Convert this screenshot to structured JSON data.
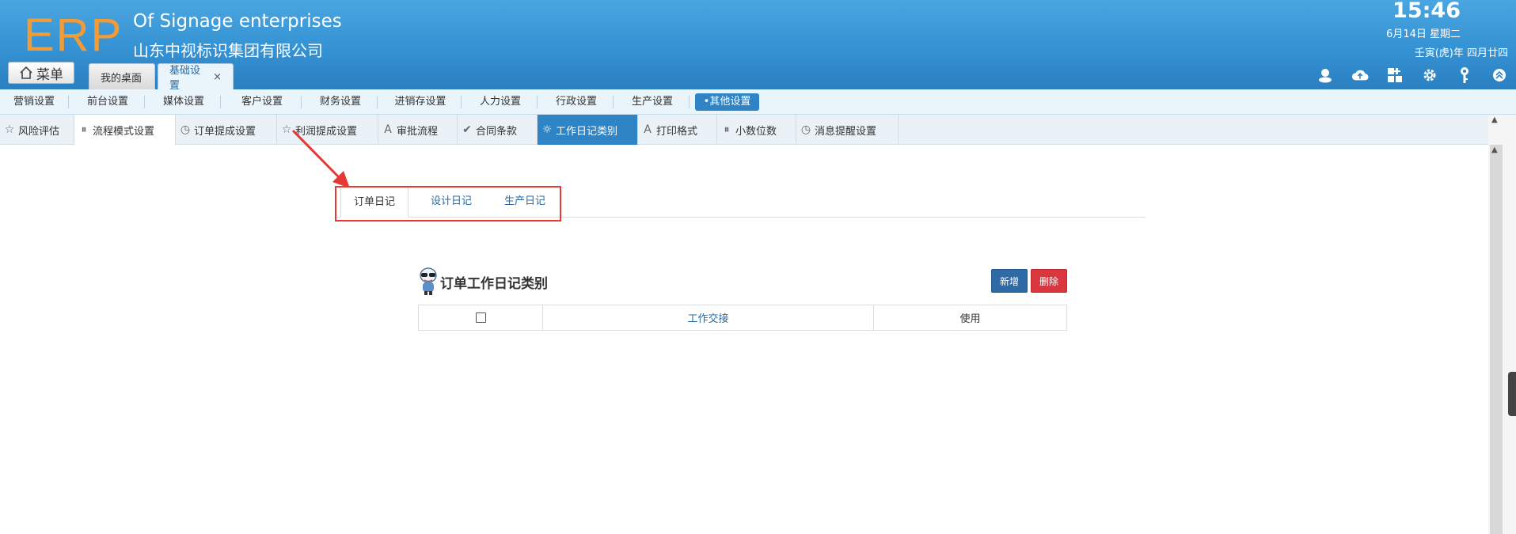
{
  "header": {
    "logo": "ERP",
    "company_en": "Of Signage enterprises",
    "company_cn": "山东中视标识集团有限公司",
    "time": "15:46",
    "date": "6月14日 星期二",
    "lunar": "壬寅(虎)年 四月廿四",
    "menu_label": "菜单",
    "tabs": [
      {
        "label": "我的桌面"
      },
      {
        "label": "基础设置",
        "close": "×"
      }
    ],
    "icons": [
      "user-icon",
      "cloud-upload-icon",
      "apps-icon",
      "gear-icon",
      "key-icon",
      "collapse-up-icon"
    ]
  },
  "categories": [
    "营销设置",
    "前台设置",
    "媒体设置",
    "客户设置",
    "财务设置",
    "进销存设置",
    "人力设置",
    "行政设置",
    "生产设置",
    "•其他设置"
  ],
  "subnav": [
    {
      "label": "风险评估",
      "icon": "☆"
    },
    {
      "label": "流程模式设置",
      "icon": "⏸"
    },
    {
      "label": "订单提成设置",
      "icon": "◷"
    },
    {
      "label": "利润提成设置",
      "icon": "☆"
    },
    {
      "label": "审批流程",
      "icon": "A"
    },
    {
      "label": "合同条款",
      "icon": "✔"
    },
    {
      "label": "工作日记类别",
      "icon": "☼"
    },
    {
      "label": "打印格式",
      "icon": "A"
    },
    {
      "label": "小数位数",
      "icon": "⏸"
    },
    {
      "label": "消息提醒设置",
      "icon": "◷"
    }
  ],
  "inner_tabs": [
    "订单日记",
    "设计日记",
    "生产日记"
  ],
  "section": {
    "title": "订单工作日记类别",
    "add_label": "新增",
    "delete_label": "删除"
  },
  "table": {
    "columns": [
      "",
      "工作交接",
      "使用"
    ]
  },
  "colors": {
    "header_blue": "#3592d3",
    "logo_orange": "#f39b35",
    "active_blue": "#2e84c5",
    "delete_red": "#d9363e",
    "highlight_red": "#e53935"
  }
}
